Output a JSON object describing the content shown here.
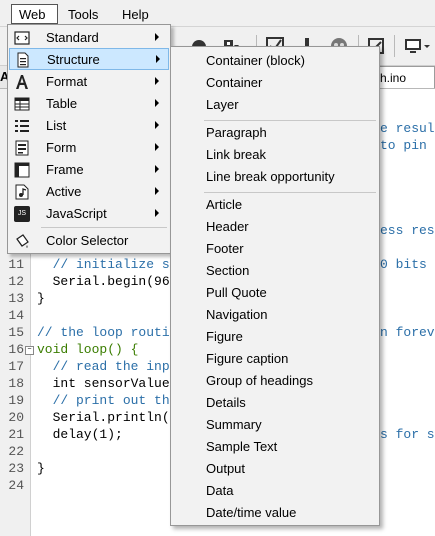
{
  "menubar": {
    "web": "Web",
    "tools": "Tools",
    "help": "Help"
  },
  "tab": {
    "left_fragment": "A",
    "right_label": "h.ino"
  },
  "web_menu": {
    "items": [
      {
        "label": "Standard",
        "icon": "standard-icon",
        "submenu": true
      },
      {
        "label": "Structure",
        "icon": "structure-icon",
        "submenu": true,
        "highlighted": true
      },
      {
        "label": "Format",
        "icon": "format-icon",
        "submenu": true
      },
      {
        "label": "Table",
        "icon": "table-icon",
        "submenu": true
      },
      {
        "label": "List",
        "icon": "list-icon",
        "submenu": true
      },
      {
        "label": "Form",
        "icon": "form-icon",
        "submenu": true
      },
      {
        "label": "Frame",
        "icon": "frame-icon",
        "submenu": true
      },
      {
        "label": "Active",
        "icon": "active-icon",
        "submenu": true
      },
      {
        "label": "JavaScript",
        "icon": "javascript-icon",
        "submenu": true
      },
      {
        "label": "Color Selector",
        "icon": "color-selector-icon",
        "submenu": false
      }
    ],
    "js_icon_text": "JS"
  },
  "structure_submenu": {
    "group1": [
      "Container (block)",
      "Container",
      "Layer"
    ],
    "group2": [
      "Paragraph",
      "Link break",
      "Line break opportunity"
    ],
    "group3": [
      "Article",
      "Header",
      "Footer",
      "Section",
      "Pull Quote",
      "Navigation",
      "Figure",
      "Figure caption",
      "Group of headings",
      "Details",
      "Summary",
      "Sample Text",
      "Output",
      "Data",
      "Date/time value"
    ]
  },
  "editor": {
    "right_fragments": [
      {
        "line": "6",
        "text": "e resul"
      },
      {
        "line": "7",
        "text": "to pin"
      },
      {
        "line": "10",
        "text": "ess rese"
      },
      {
        "line": "11",
        "text": "0 bits"
      },
      {
        "line": "15",
        "text": "n forev"
      },
      {
        "line": "21",
        "text": "s for s"
      }
    ],
    "lines": [
      {
        "n": "11",
        "code": "  // initialize s"
      },
      {
        "n": "12",
        "code": "  Serial.begin(96"
      },
      {
        "n": "13",
        "code": "}"
      },
      {
        "n": "14",
        "code": ""
      },
      {
        "n": "15",
        "code": "// the loop routi"
      },
      {
        "n": "16",
        "code": "void loop() {"
      },
      {
        "n": "17",
        "code": "  // read the inp"
      },
      {
        "n": "18",
        "code": "  int sensorValue"
      },
      {
        "n": "19",
        "code": "  // print out th"
      },
      {
        "n": "20",
        "code": "  Serial.println("
      },
      {
        "n": "21",
        "code": "  delay(1);"
      },
      {
        "n": "22",
        "code": ""
      },
      {
        "n": "23",
        "code": "}"
      },
      {
        "n": "24",
        "code": ""
      }
    ]
  },
  "colors": {
    "highlight": "#cce8ff",
    "comment": "#2b6fa8",
    "keyword": "#3a7d00",
    "function": "#a2561a",
    "number": "#1b8a5a"
  }
}
